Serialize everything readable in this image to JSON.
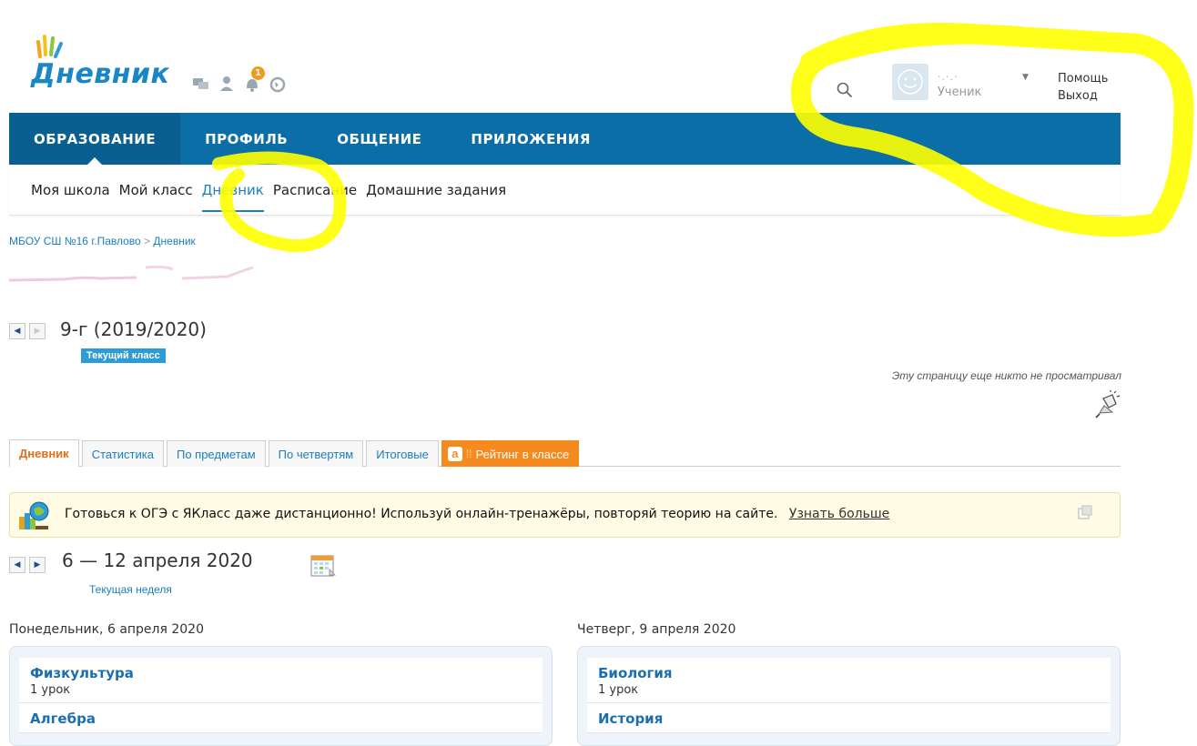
{
  "app": {
    "logo_text": "Дневник",
    "notification_count": "1"
  },
  "user": {
    "name": "·.·.·",
    "role": "Ученик",
    "help": "Помощь",
    "logout": "Выход"
  },
  "main_nav": [
    {
      "label": "ОБРАЗОВАНИЕ",
      "active": true
    },
    {
      "label": "ПРОФИЛЬ",
      "active": false
    },
    {
      "label": "ОБЩЕНИЕ",
      "active": false
    },
    {
      "label": "ПРИЛОЖЕНИЯ",
      "active": false
    }
  ],
  "sub_nav": [
    {
      "label": "Моя школа",
      "active": false
    },
    {
      "label": "Мой класс",
      "active": false
    },
    {
      "label": "Дневник",
      "active": true
    },
    {
      "label": "Расписание",
      "active": false
    },
    {
      "label": "Домашние задания",
      "active": false
    }
  ],
  "breadcrumb": {
    "school": "МБОУ СШ №16 г.Павлово",
    "separator": ">",
    "current": "Дневник"
  },
  "class_selector": {
    "title": "9-г (2019/2020)",
    "badge": "Текущий класс"
  },
  "views_note": "Эту страницу еще никто не просматривал",
  "tabs": [
    {
      "label": "Дневник",
      "active": true
    },
    {
      "label": "Статистика",
      "active": false
    },
    {
      "label": "По предметам",
      "active": false
    },
    {
      "label": "По четвертям",
      "active": false
    },
    {
      "label": "Итоговые",
      "active": false
    },
    {
      "label": "Рейтинг в классе",
      "active": false,
      "logo": "a"
    }
  ],
  "banner": {
    "text": "Готовься к ОГЭ с ЯКласс даже дистанционно! Используй онлайн-тренажёры, повторяй теорию на сайте.",
    "link": "Узнать больше"
  },
  "week_selector": {
    "title": "6 — 12 апреля 2020",
    "subtitle": "Текущая неделя"
  },
  "days": [
    {
      "label": "Понедельник, 6 апреля 2020",
      "lessons": [
        {
          "name": "Физкультура",
          "number": "1 урок"
        },
        {
          "name": "Алгебра",
          "number": ""
        }
      ]
    },
    {
      "label": "Четверг, 9 апреля 2020",
      "lessons": [
        {
          "name": "Биология",
          "number": "1 урок"
        },
        {
          "name": "История",
          "number": ""
        }
      ]
    }
  ],
  "colors": {
    "brand_blue": "#0b6ea6",
    "link_blue": "#1b7fbd",
    "accent_orange": "#f58a1f",
    "badge_blue": "#2d9bd6",
    "annotation_yellow": "#ffff00"
  }
}
